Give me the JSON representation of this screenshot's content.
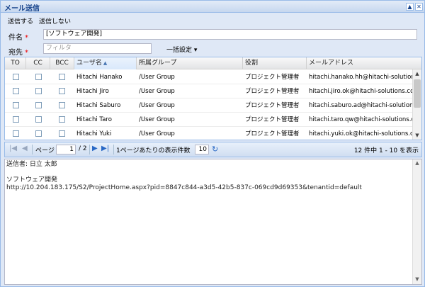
{
  "window": {
    "title": "メール送信"
  },
  "toolbar": {
    "send_label": "送信する",
    "nosend_label": "送信しない"
  },
  "subject": {
    "label": "件名",
    "required": "*",
    "value": "[ソフトウェア開発]"
  },
  "recipients": {
    "label": "宛先",
    "required": "*",
    "placeholder": "フィルタ",
    "bulk_label": "一括設定"
  },
  "grid": {
    "headers": {
      "to": "TO",
      "cc": "CC",
      "bcc": "BCC",
      "user": "ユーザ名",
      "group": "所属グループ",
      "role": "役割",
      "email": "メールアドレス"
    },
    "rows": [
      {
        "user": "Hitachi Hanako",
        "group": "/User Group",
        "role": "プロジェクト管理者",
        "email": "hitachi.hanako.hh@hitachi-solutions...."
      },
      {
        "user": "Hitachi Jiro",
        "group": "/User Group",
        "role": "プロジェクト管理者",
        "email": "hitachi.jiro.ok@hitachi-solutions.com"
      },
      {
        "user": "Hitachi Saburo",
        "group": "/User Group",
        "role": "プロジェクト管理者",
        "email": "hitachi.saburo.ad@hitachi-solutions.com"
      },
      {
        "user": "Hitachi Taro",
        "group": "/User Group",
        "role": "プロジェクト管理者",
        "email": "hitachi.taro.qw@hitachi-solutions.com"
      },
      {
        "user": "Hitachi Yuki",
        "group": "/User Group",
        "role": "プロジェクト管理者",
        "email": "hitachi.yuki.ok@hitachi-solutions.com"
      }
    ]
  },
  "pager": {
    "page_label": "ページ",
    "page_value": "1",
    "page_total": "/ 2",
    "per_page_label": "1ページあたりの表示件数",
    "per_page_value": "10",
    "summary": "12 件中 1 - 10 を表示"
  },
  "message": {
    "body": "送信者: 日立 太郎\n\nソフトウェア開発\nhttp://10.204.183.175/S2/ProjectHome.aspx?pid=8847c844-a3d5-42b5-837c-069cd9d69353&tenantid=default"
  },
  "colors": {
    "header_text": "#15428b",
    "border": "#99bbe8",
    "panel_bg": "#dfe8f6",
    "required": "#ee0000",
    "pager_active": "#2767c5"
  }
}
